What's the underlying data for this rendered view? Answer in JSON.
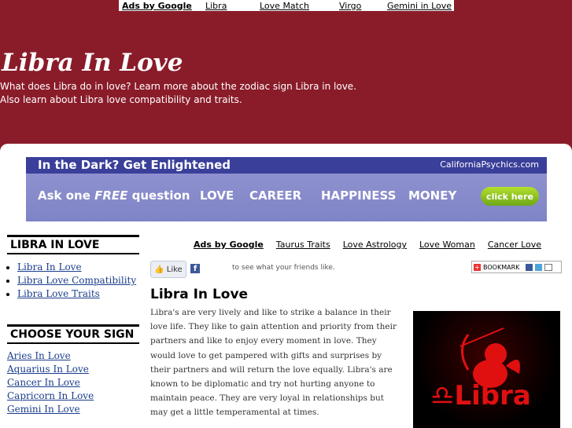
{
  "topbar": {
    "ads_label": "Ads by Google",
    "links": [
      "Libra",
      "Love Match",
      "Virgo",
      "Gemini in Love"
    ]
  },
  "header": {
    "title": "Libra In Love",
    "description": "What does Libra do in love? Learn more about the zodiac sign Libra in love. Also learn about Libra love compatibility and traits."
  },
  "banner": {
    "headline": "In the Dark? Get Enlightened",
    "brand": "CaliforniaPsychics.com",
    "ask_prefix": "Ask one ",
    "ask_free": "FREE",
    "ask_suffix": " question",
    "categories": [
      "LOVE",
      "CAREER",
      "HAPPINESS",
      "MONEY"
    ],
    "cta": "click here"
  },
  "sidebar": {
    "box1_title": "LIBRA IN LOVE",
    "box1_links": [
      "Libra In Love",
      "Libra Love Compatibility",
      "Libra Love Traits"
    ],
    "box2_title": "CHOOSE YOUR SIGN",
    "box2_links": [
      "Aries In Love",
      "Aquarius In Love",
      "Cancer In Love",
      "Capricorn In Love",
      "Gemini In Love"
    ]
  },
  "adlinks": {
    "ads_label": "Ads by Google",
    "links": [
      "Taurus Traits",
      "Love Astrology",
      "Love Woman",
      "Cancer Love"
    ]
  },
  "social": {
    "like_label": "Like",
    "like_text": "to see what your friends like.",
    "bookmark_label": "BOOKMARK"
  },
  "content": {
    "title": "Libra In Love",
    "body": "Libra's are very lively and like to strike a balance in their love life. They like to gain attention and priority from their partners and like to enjoy every moment in love. They would love to get pampered with gifts and surprises by their partners and will return the love equally. Libra's are known to be diplomatic and try not hurting anyone to maintain peace. They are very loyal in relationships but may get a little temperamental at times.",
    "image_label": "♎Libra"
  },
  "colors": {
    "header_bg": "#8a1c2a",
    "link": "#1a3d8c",
    "banner_bg": "#3a3f9a",
    "cta": "#8cc21f"
  }
}
